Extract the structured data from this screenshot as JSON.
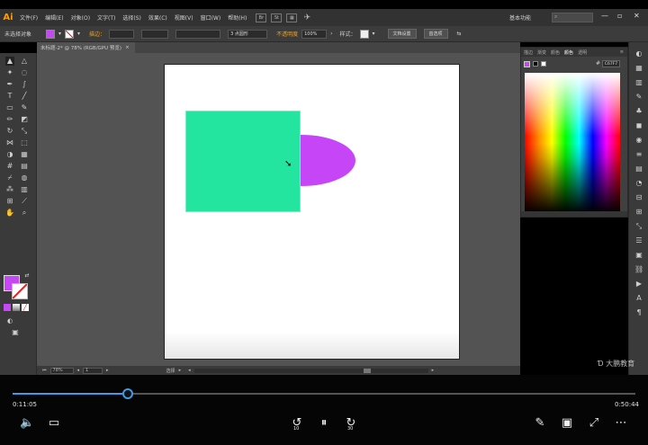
{
  "app": {
    "logo": "Ai",
    "menu": [
      "文件(F)",
      "编辑(E)",
      "对象(O)",
      "文字(T)",
      "选择(S)",
      "效果(C)",
      "视图(V)",
      "窗口(W)",
      "帮助(H)"
    ],
    "workspace": "基本功能",
    "menubar_icons": [
      "Br",
      "St"
    ]
  },
  "control_bar": {
    "selection_status": "未选择对象",
    "fill_color": "#c648f5",
    "stroke_label": "描边：",
    "brush_value": "3 点圆形",
    "opacity_label": "不透明度",
    "opacity_value": "100%",
    "style_label": "样式：",
    "doc_setup_button": "文档设置",
    "preferences_button": "首选项"
  },
  "document_tab": {
    "title": "未标题-2* @ 78% (RGB/GPU 预览)",
    "close": "×"
  },
  "canvas": {
    "rectangle_color": "#23e5a0",
    "ellipse_color": "#c646f7",
    "artboard_color": "#ffffff"
  },
  "status_bar": {
    "zoom": "78%",
    "page": "1",
    "mode": "选择"
  },
  "color_panel": {
    "tabs": [
      "描边",
      "渐变",
      "颜色",
      "颜色",
      "透明"
    ],
    "active_tab_index": 3,
    "hex_value": "C67F7"
  },
  "watermark": "大鹏教育",
  "player": {
    "current_time": "0:11:05",
    "total_time": "0:50:44",
    "progress_fraction": 0.185,
    "skip_back_label": "10",
    "skip_forward_label": "30",
    "accent": "#3d9be8"
  }
}
